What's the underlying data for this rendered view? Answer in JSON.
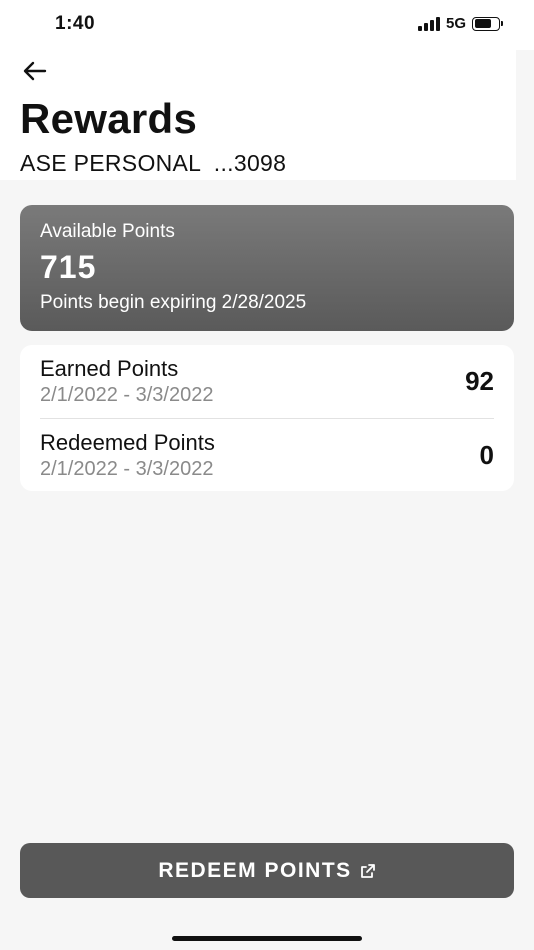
{
  "status_bar": {
    "time": "1:40",
    "network": "5G",
    "icons": [
      "signal-icon",
      "battery-icon"
    ]
  },
  "header": {
    "back_icon": "arrow-left-icon",
    "title": "Rewards",
    "account": "ASE PERSONAL  ...3098"
  },
  "available": {
    "label": "Available Points",
    "value": "715",
    "note": "Points begin expiring 2/28/2025"
  },
  "points": [
    {
      "label": "Earned Points",
      "range": "2/1/2022 - 3/3/2022",
      "value": "92"
    },
    {
      "label": "Redeemed Points",
      "range": "2/1/2022 - 3/3/2022",
      "value": "0"
    }
  ],
  "redeem": {
    "label": "REDEEM POINTS",
    "icon": "external-link-icon"
  },
  "colors": {
    "card_top": "#7a7a7a",
    "card_bottom": "#5a5a5a",
    "button": "#585858",
    "muted_text": "#8a8a8a"
  }
}
